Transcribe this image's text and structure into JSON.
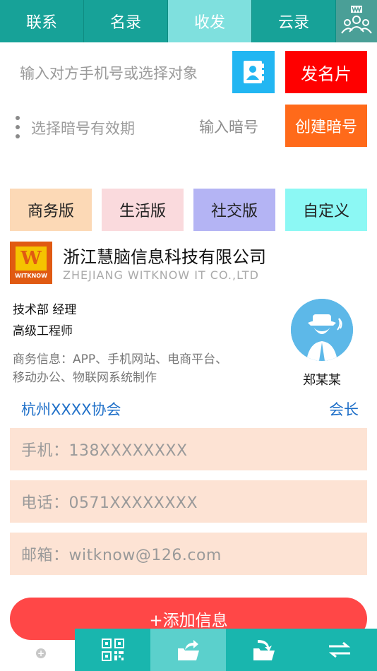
{
  "tabs": [
    {
      "label": "联系",
      "active": false
    },
    {
      "label": "名录",
      "active": false
    },
    {
      "label": "收发",
      "active": true
    },
    {
      "label": "云录",
      "active": false
    }
  ],
  "tab_avatar_icon": "group-users-icon",
  "send": {
    "phone_placeholder": "输入对方手机号或选择对象",
    "contacts_icon": "address-book-icon",
    "send_card_label": "发名片"
  },
  "code": {
    "validity_label": "选择暗号有效期",
    "code_placeholder": "输入暗号",
    "create_label": "创建暗号"
  },
  "versions": [
    {
      "label": "商务版",
      "color": "#fcd9b6"
    },
    {
      "label": "生活版",
      "color": "#fadadd"
    },
    {
      "label": "社交版",
      "color": "#b4b4f4"
    },
    {
      "label": "自定义",
      "color": "#8cf8f4"
    }
  ],
  "company": {
    "logo_text": "WITKNOW",
    "logo_letter": "W",
    "name": "浙江慧脑信息科技有限公司",
    "name_en": "ZHEJIANG WITKNOW IT CO.,LTD"
  },
  "person": {
    "department": "技术部 经理",
    "title": "高级工程师",
    "business": "商务信息：APP、手机网站、电商平台、移动办公、物联网系统制作",
    "name": "郑某某"
  },
  "association": {
    "name": "杭州XXXX协会",
    "role": "会长"
  },
  "fields": [
    {
      "label": "手机：138XXXXXXXX"
    },
    {
      "label": "电话：0571XXXXXXXX"
    },
    {
      "label": "邮箱：witknow@126.com"
    }
  ],
  "add_label": "+添加信息",
  "bottom_nav": [
    {
      "icon": "qr-code-icon",
      "active": false
    },
    {
      "icon": "send-folder-icon",
      "active": true
    },
    {
      "icon": "receive-folder-icon",
      "active": false
    },
    {
      "icon": "swap-arrows-icon",
      "active": false
    }
  ],
  "colors": {
    "topbar": "#17a298",
    "active_tab": "#7fe0de",
    "send_button": "#ff0000",
    "create_button": "#ff6a1a",
    "field_bg": "#fde3d4",
    "add_button": "#ff4747",
    "bottom_bar": "#19b6ae",
    "link_blue": "#1e6fc8"
  }
}
